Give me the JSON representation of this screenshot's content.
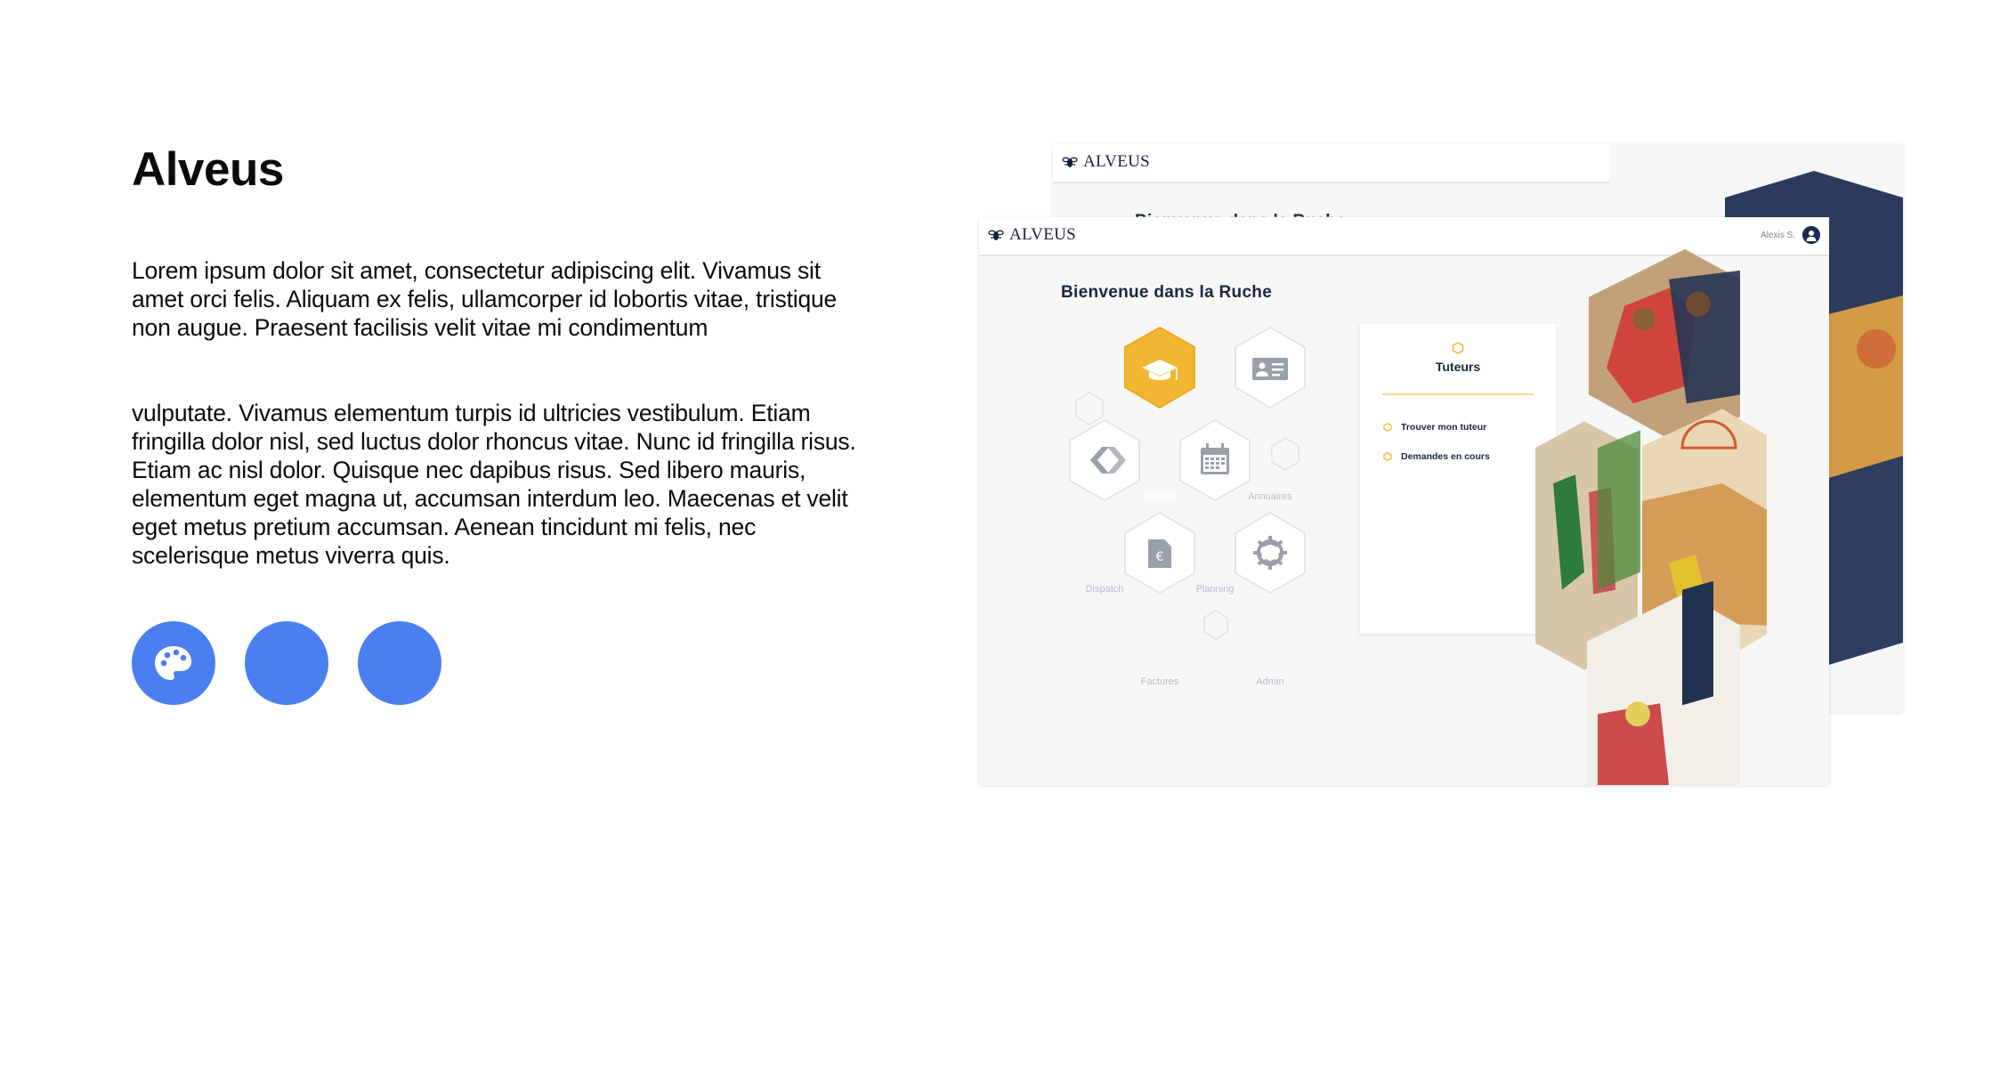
{
  "title": "Alveus",
  "paragraphs": [
    "Lorem ipsum dolor sit amet, consectetur adipiscing elit. Vivamus sit amet orci felis. Aliquam ex felis, ullamcorper id lobortis vitae, tristique non augue. Praesent facilisis velit vitae mi condimentum",
    "vulputate. Vivamus elementum turpis id ultricies vestibulum. Etiam fringilla dolor nisl, sed luctus dolor rhoncus vitae. Nunc id fringilla risus. Etiam ac nisl dolor. Quisque nec dapibus risus. Sed libero mauris, elementum eget magna ut, accumsan interdum leo. Maecenas et velit eget metus pretium accumsan. Aenean tincidunt mi felis, nec scelerisque metus viverra quis."
  ],
  "buttons": [
    {
      "icon": "palette-icon"
    },
    {
      "icon": ""
    },
    {
      "icon": ""
    }
  ],
  "mockup": {
    "logo_text": "ALVEUS",
    "user_name": "Alexis S.",
    "welcome": "Bienvenue dans la Ruche",
    "tiles": [
      "Tuteurs",
      "Annuaires",
      "Dispatch",
      "Planning",
      "Factures",
      "Admin"
    ],
    "active_tile": "Tuteurs",
    "panel": {
      "title": "Tuteurs",
      "items": [
        "Trouver mon tuteur",
        "Demandes en cours"
      ]
    },
    "colors": {
      "accent": "#f2b632",
      "navy": "#1a2740",
      "button_blue": "#4b7ff1"
    }
  }
}
